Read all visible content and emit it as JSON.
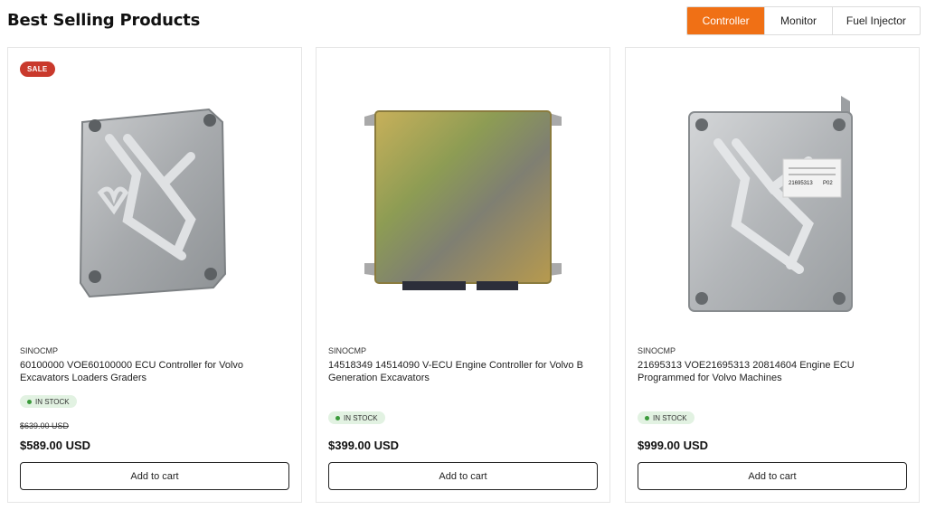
{
  "header": {
    "title": "Best Selling Products"
  },
  "tabs": [
    {
      "label": "Controller",
      "active": true
    },
    {
      "label": "Monitor",
      "active": false
    },
    {
      "label": "Fuel Injector",
      "active": false
    }
  ],
  "colors": {
    "accent": "#f07015",
    "sale": "#c9392c",
    "stock_bg": "#e2f2e2",
    "stock_dot": "#3a9a3a"
  },
  "products": [
    {
      "badge": "SALE",
      "vendor": "SINOCMP",
      "title": "60100000 VOE60100000 ECU Controller for Volvo Excavators Loaders Graders",
      "stock": "IN STOCK",
      "old_price": "$639.00 USD",
      "price": "$589.00 USD",
      "cart_label": "Add to cart",
      "image_icon": "ecu-silver-icon"
    },
    {
      "vendor": "SINOCMP",
      "title": "14518349 14514090 V-ECU Engine Controller for Volvo B Generation Excavators",
      "stock": "IN STOCK",
      "price": "$399.00 USD",
      "cart_label": "Add to cart",
      "image_icon": "ecu-gold-icon"
    },
    {
      "vendor": "SINOCMP",
      "title": "21695313 VOE21695313 20814604 Engine ECU Programmed for Volvo Machines",
      "stock": "IN STOCK",
      "price": "$999.00 USD",
      "cart_label": "Add to cart",
      "image_icon": "ecu-labeled-icon",
      "label_text": [
        "21695313",
        "P02"
      ]
    }
  ]
}
